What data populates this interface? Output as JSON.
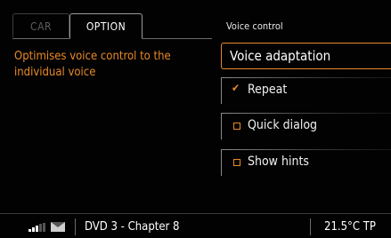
{
  "tabs": {
    "car": "CAR",
    "option": "OPTION"
  },
  "description": "Optimises voice control to the individual voice",
  "section_title": "Voice control",
  "menu": {
    "voice_adaptation": "Voice adaptation",
    "items": [
      {
        "label": "Repeat",
        "checked": true
      },
      {
        "label": "Quick dialog",
        "checked": false
      },
      {
        "label": "Show hints",
        "checked": false
      }
    ]
  },
  "status_bar": {
    "icons": [
      "signal-strength-icon",
      "envelope-icon"
    ],
    "media": "DVD 3 - Chapter 8",
    "temperature": "21.5°C TP"
  },
  "colors": {
    "accent": "#e88a28",
    "background": "#020202",
    "text": "#ffffff"
  }
}
